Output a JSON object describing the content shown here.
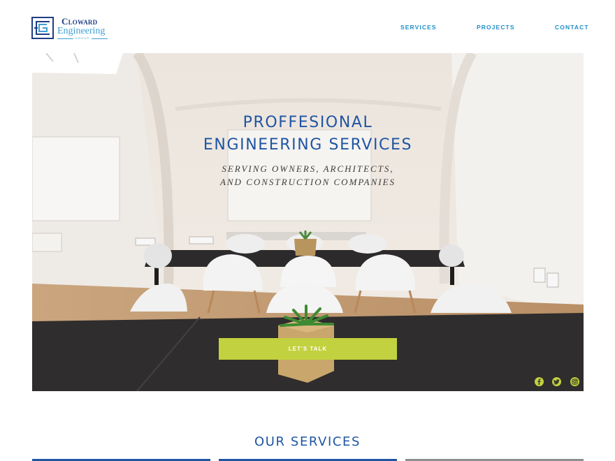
{
  "logo": {
    "line1": "Cloward",
    "line2": "Engineering",
    "line3": "GROUP",
    "mark_color": "#1f3f86",
    "accent_color": "#3f9fd3"
  },
  "nav": {
    "services": "SERVICES",
    "projects": "PROJECTS",
    "contact": "CONTACT",
    "color": "#1f8fc7"
  },
  "hero": {
    "title": "PROFFESIONAL\nENGINEERING SERVICES",
    "subtitle": "SERVING OWNERS, ARCHITECTS,\nAND CONSTRUCTION COMPANIES",
    "cta_label": "LET'S TALK",
    "cta_color": "#c2d13f",
    "title_color": "#1f55a3"
  },
  "social": {
    "icons": [
      "facebook-icon",
      "twitter-icon",
      "instagram-icon"
    ],
    "color": "#c2d13f"
  },
  "services": {
    "title": "OUR SERVICES",
    "bar_colors": [
      "#1f55a3",
      "#1f55a3",
      "#8f8f8f"
    ]
  }
}
